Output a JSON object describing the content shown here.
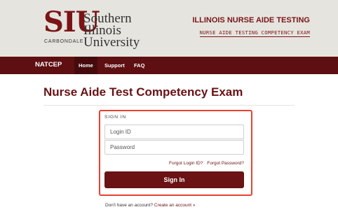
{
  "header": {
    "logo_mark": "SIU",
    "logo_name": "Southern Illinois University",
    "logo_campus": "CARBONDALE",
    "program_title": "ILLINOIS NURSE AIDE TESTING",
    "program_subtitle": "NURSE AIDE TESTING COMPETENCY EXAM"
  },
  "nav": {
    "brand": "NATCEP",
    "items": [
      {
        "label": "Home",
        "active": true
      },
      {
        "label": "Support",
        "active": false
      },
      {
        "label": "FAQ",
        "active": false
      }
    ]
  },
  "page": {
    "title": "Nurse Aide Test Competency Exam"
  },
  "signin": {
    "heading": "SIGN IN",
    "login_placeholder": "Login ID",
    "password_placeholder": "Password",
    "forgot_login": "Forgot Login ID?",
    "forgot_password": "Forgot Password?",
    "button_label": "Sign In"
  },
  "footer": {
    "prompt": "Don't have an account?",
    "create_link": "Create an account »"
  },
  "colors": {
    "brand_maroon": "#6a1214",
    "nav_bg": "#5e0f12",
    "header_bg": "#e6e4df",
    "highlight": "#e8412f"
  }
}
